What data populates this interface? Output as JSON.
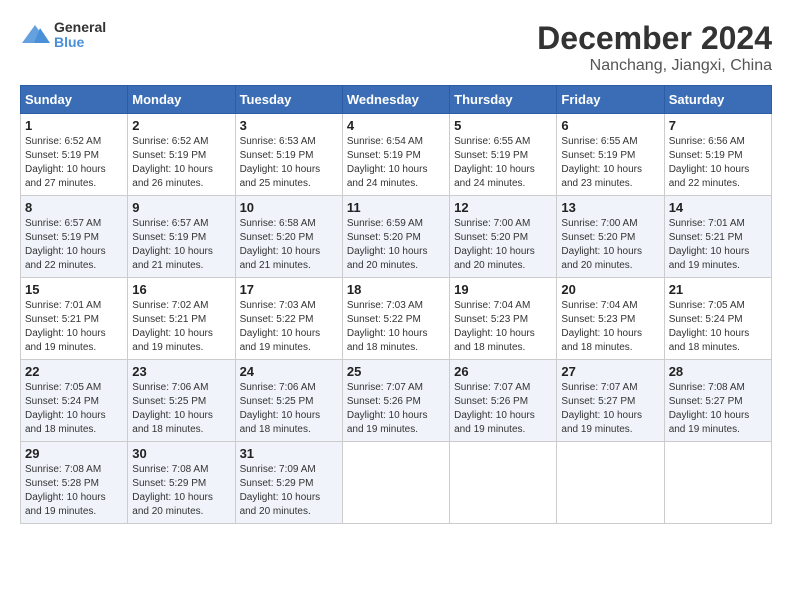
{
  "header": {
    "logo_line1": "General",
    "logo_line2": "Blue",
    "month_title": "December 2024",
    "location": "Nanchang, Jiangxi, China"
  },
  "calendar": {
    "days_of_week": [
      "Sunday",
      "Monday",
      "Tuesday",
      "Wednesday",
      "Thursday",
      "Friday",
      "Saturday"
    ],
    "weeks": [
      [
        null,
        null,
        null,
        null,
        null,
        null,
        null
      ]
    ],
    "cells": [
      {
        "date": 1,
        "sunrise": "6:52 AM",
        "sunset": "5:19 PM",
        "daylight": "10 hours and 27 minutes."
      },
      {
        "date": 2,
        "sunrise": "6:52 AM",
        "sunset": "5:19 PM",
        "daylight": "10 hours and 26 minutes."
      },
      {
        "date": 3,
        "sunrise": "6:53 AM",
        "sunset": "5:19 PM",
        "daylight": "10 hours and 25 minutes."
      },
      {
        "date": 4,
        "sunrise": "6:54 AM",
        "sunset": "5:19 PM",
        "daylight": "10 hours and 24 minutes."
      },
      {
        "date": 5,
        "sunrise": "6:55 AM",
        "sunset": "5:19 PM",
        "daylight": "10 hours and 24 minutes."
      },
      {
        "date": 6,
        "sunrise": "6:55 AM",
        "sunset": "5:19 PM",
        "daylight": "10 hours and 23 minutes."
      },
      {
        "date": 7,
        "sunrise": "6:56 AM",
        "sunset": "5:19 PM",
        "daylight": "10 hours and 22 minutes."
      },
      {
        "date": 8,
        "sunrise": "6:57 AM",
        "sunset": "5:19 PM",
        "daylight": "10 hours and 22 minutes."
      },
      {
        "date": 9,
        "sunrise": "6:57 AM",
        "sunset": "5:19 PM",
        "daylight": "10 hours and 21 minutes."
      },
      {
        "date": 10,
        "sunrise": "6:58 AM",
        "sunset": "5:20 PM",
        "daylight": "10 hours and 21 minutes."
      },
      {
        "date": 11,
        "sunrise": "6:59 AM",
        "sunset": "5:20 PM",
        "daylight": "10 hours and 20 minutes."
      },
      {
        "date": 12,
        "sunrise": "7:00 AM",
        "sunset": "5:20 PM",
        "daylight": "10 hours and 20 minutes."
      },
      {
        "date": 13,
        "sunrise": "7:00 AM",
        "sunset": "5:20 PM",
        "daylight": "10 hours and 20 minutes."
      },
      {
        "date": 14,
        "sunrise": "7:01 AM",
        "sunset": "5:21 PM",
        "daylight": "10 hours and 19 minutes."
      },
      {
        "date": 15,
        "sunrise": "7:01 AM",
        "sunset": "5:21 PM",
        "daylight": "10 hours and 19 minutes."
      },
      {
        "date": 16,
        "sunrise": "7:02 AM",
        "sunset": "5:21 PM",
        "daylight": "10 hours and 19 minutes."
      },
      {
        "date": 17,
        "sunrise": "7:03 AM",
        "sunset": "5:22 PM",
        "daylight": "10 hours and 19 minutes."
      },
      {
        "date": 18,
        "sunrise": "7:03 AM",
        "sunset": "5:22 PM",
        "daylight": "10 hours and 18 minutes."
      },
      {
        "date": 19,
        "sunrise": "7:04 AM",
        "sunset": "5:23 PM",
        "daylight": "10 hours and 18 minutes."
      },
      {
        "date": 20,
        "sunrise": "7:04 AM",
        "sunset": "5:23 PM",
        "daylight": "10 hours and 18 minutes."
      },
      {
        "date": 21,
        "sunrise": "7:05 AM",
        "sunset": "5:24 PM",
        "daylight": "10 hours and 18 minutes."
      },
      {
        "date": 22,
        "sunrise": "7:05 AM",
        "sunset": "5:24 PM",
        "daylight": "10 hours and 18 minutes."
      },
      {
        "date": 23,
        "sunrise": "7:06 AM",
        "sunset": "5:25 PM",
        "daylight": "10 hours and 18 minutes."
      },
      {
        "date": 24,
        "sunrise": "7:06 AM",
        "sunset": "5:25 PM",
        "daylight": "10 hours and 18 minutes."
      },
      {
        "date": 25,
        "sunrise": "7:07 AM",
        "sunset": "5:26 PM",
        "daylight": "10 hours and 19 minutes."
      },
      {
        "date": 26,
        "sunrise": "7:07 AM",
        "sunset": "5:26 PM",
        "daylight": "10 hours and 19 minutes."
      },
      {
        "date": 27,
        "sunrise": "7:07 AM",
        "sunset": "5:27 PM",
        "daylight": "10 hours and 19 minutes."
      },
      {
        "date": 28,
        "sunrise": "7:08 AM",
        "sunset": "5:27 PM",
        "daylight": "10 hours and 19 minutes."
      },
      {
        "date": 29,
        "sunrise": "7:08 AM",
        "sunset": "5:28 PM",
        "daylight": "10 hours and 19 minutes."
      },
      {
        "date": 30,
        "sunrise": "7:08 AM",
        "sunset": "5:29 PM",
        "daylight": "10 hours and 20 minutes."
      },
      {
        "date": 31,
        "sunrise": "7:09 AM",
        "sunset": "5:29 PM",
        "daylight": "10 hours and 20 minutes."
      }
    ]
  }
}
